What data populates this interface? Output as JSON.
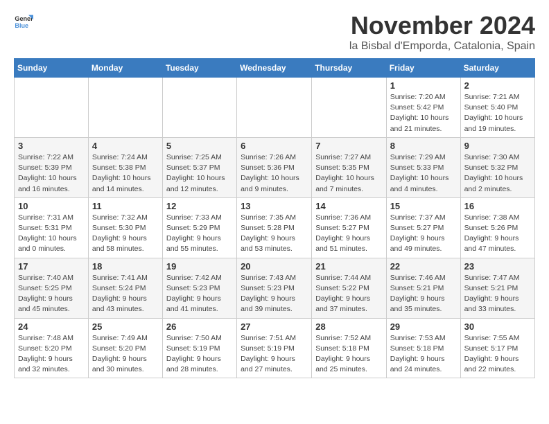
{
  "logo": {
    "line1": "General",
    "line2": "Blue"
  },
  "title": "November 2024",
  "location": "la Bisbal d'Emporda, Catalonia, Spain",
  "weekdays": [
    "Sunday",
    "Monday",
    "Tuesday",
    "Wednesday",
    "Thursday",
    "Friday",
    "Saturday"
  ],
  "weeks": [
    [
      {
        "day": "",
        "info": ""
      },
      {
        "day": "",
        "info": ""
      },
      {
        "day": "",
        "info": ""
      },
      {
        "day": "",
        "info": ""
      },
      {
        "day": "",
        "info": ""
      },
      {
        "day": "1",
        "info": "Sunrise: 7:20 AM\nSunset: 5:42 PM\nDaylight: 10 hours and 21 minutes."
      },
      {
        "day": "2",
        "info": "Sunrise: 7:21 AM\nSunset: 5:40 PM\nDaylight: 10 hours and 19 minutes."
      }
    ],
    [
      {
        "day": "3",
        "info": "Sunrise: 7:22 AM\nSunset: 5:39 PM\nDaylight: 10 hours and 16 minutes."
      },
      {
        "day": "4",
        "info": "Sunrise: 7:24 AM\nSunset: 5:38 PM\nDaylight: 10 hours and 14 minutes."
      },
      {
        "day": "5",
        "info": "Sunrise: 7:25 AM\nSunset: 5:37 PM\nDaylight: 10 hours and 12 minutes."
      },
      {
        "day": "6",
        "info": "Sunrise: 7:26 AM\nSunset: 5:36 PM\nDaylight: 10 hours and 9 minutes."
      },
      {
        "day": "7",
        "info": "Sunrise: 7:27 AM\nSunset: 5:35 PM\nDaylight: 10 hours and 7 minutes."
      },
      {
        "day": "8",
        "info": "Sunrise: 7:29 AM\nSunset: 5:33 PM\nDaylight: 10 hours and 4 minutes."
      },
      {
        "day": "9",
        "info": "Sunrise: 7:30 AM\nSunset: 5:32 PM\nDaylight: 10 hours and 2 minutes."
      }
    ],
    [
      {
        "day": "10",
        "info": "Sunrise: 7:31 AM\nSunset: 5:31 PM\nDaylight: 10 hours and 0 minutes."
      },
      {
        "day": "11",
        "info": "Sunrise: 7:32 AM\nSunset: 5:30 PM\nDaylight: 9 hours and 58 minutes."
      },
      {
        "day": "12",
        "info": "Sunrise: 7:33 AM\nSunset: 5:29 PM\nDaylight: 9 hours and 55 minutes."
      },
      {
        "day": "13",
        "info": "Sunrise: 7:35 AM\nSunset: 5:28 PM\nDaylight: 9 hours and 53 minutes."
      },
      {
        "day": "14",
        "info": "Sunrise: 7:36 AM\nSunset: 5:27 PM\nDaylight: 9 hours and 51 minutes."
      },
      {
        "day": "15",
        "info": "Sunrise: 7:37 AM\nSunset: 5:27 PM\nDaylight: 9 hours and 49 minutes."
      },
      {
        "day": "16",
        "info": "Sunrise: 7:38 AM\nSunset: 5:26 PM\nDaylight: 9 hours and 47 minutes."
      }
    ],
    [
      {
        "day": "17",
        "info": "Sunrise: 7:40 AM\nSunset: 5:25 PM\nDaylight: 9 hours and 45 minutes."
      },
      {
        "day": "18",
        "info": "Sunrise: 7:41 AM\nSunset: 5:24 PM\nDaylight: 9 hours and 43 minutes."
      },
      {
        "day": "19",
        "info": "Sunrise: 7:42 AM\nSunset: 5:23 PM\nDaylight: 9 hours and 41 minutes."
      },
      {
        "day": "20",
        "info": "Sunrise: 7:43 AM\nSunset: 5:23 PM\nDaylight: 9 hours and 39 minutes."
      },
      {
        "day": "21",
        "info": "Sunrise: 7:44 AM\nSunset: 5:22 PM\nDaylight: 9 hours and 37 minutes."
      },
      {
        "day": "22",
        "info": "Sunrise: 7:46 AM\nSunset: 5:21 PM\nDaylight: 9 hours and 35 minutes."
      },
      {
        "day": "23",
        "info": "Sunrise: 7:47 AM\nSunset: 5:21 PM\nDaylight: 9 hours and 33 minutes."
      }
    ],
    [
      {
        "day": "24",
        "info": "Sunrise: 7:48 AM\nSunset: 5:20 PM\nDaylight: 9 hours and 32 minutes."
      },
      {
        "day": "25",
        "info": "Sunrise: 7:49 AM\nSunset: 5:20 PM\nDaylight: 9 hours and 30 minutes."
      },
      {
        "day": "26",
        "info": "Sunrise: 7:50 AM\nSunset: 5:19 PM\nDaylight: 9 hours and 28 minutes."
      },
      {
        "day": "27",
        "info": "Sunrise: 7:51 AM\nSunset: 5:19 PM\nDaylight: 9 hours and 27 minutes."
      },
      {
        "day": "28",
        "info": "Sunrise: 7:52 AM\nSunset: 5:18 PM\nDaylight: 9 hours and 25 minutes."
      },
      {
        "day": "29",
        "info": "Sunrise: 7:53 AM\nSunset: 5:18 PM\nDaylight: 9 hours and 24 minutes."
      },
      {
        "day": "30",
        "info": "Sunrise: 7:55 AM\nSunset: 5:17 PM\nDaylight: 9 hours and 22 minutes."
      }
    ]
  ]
}
